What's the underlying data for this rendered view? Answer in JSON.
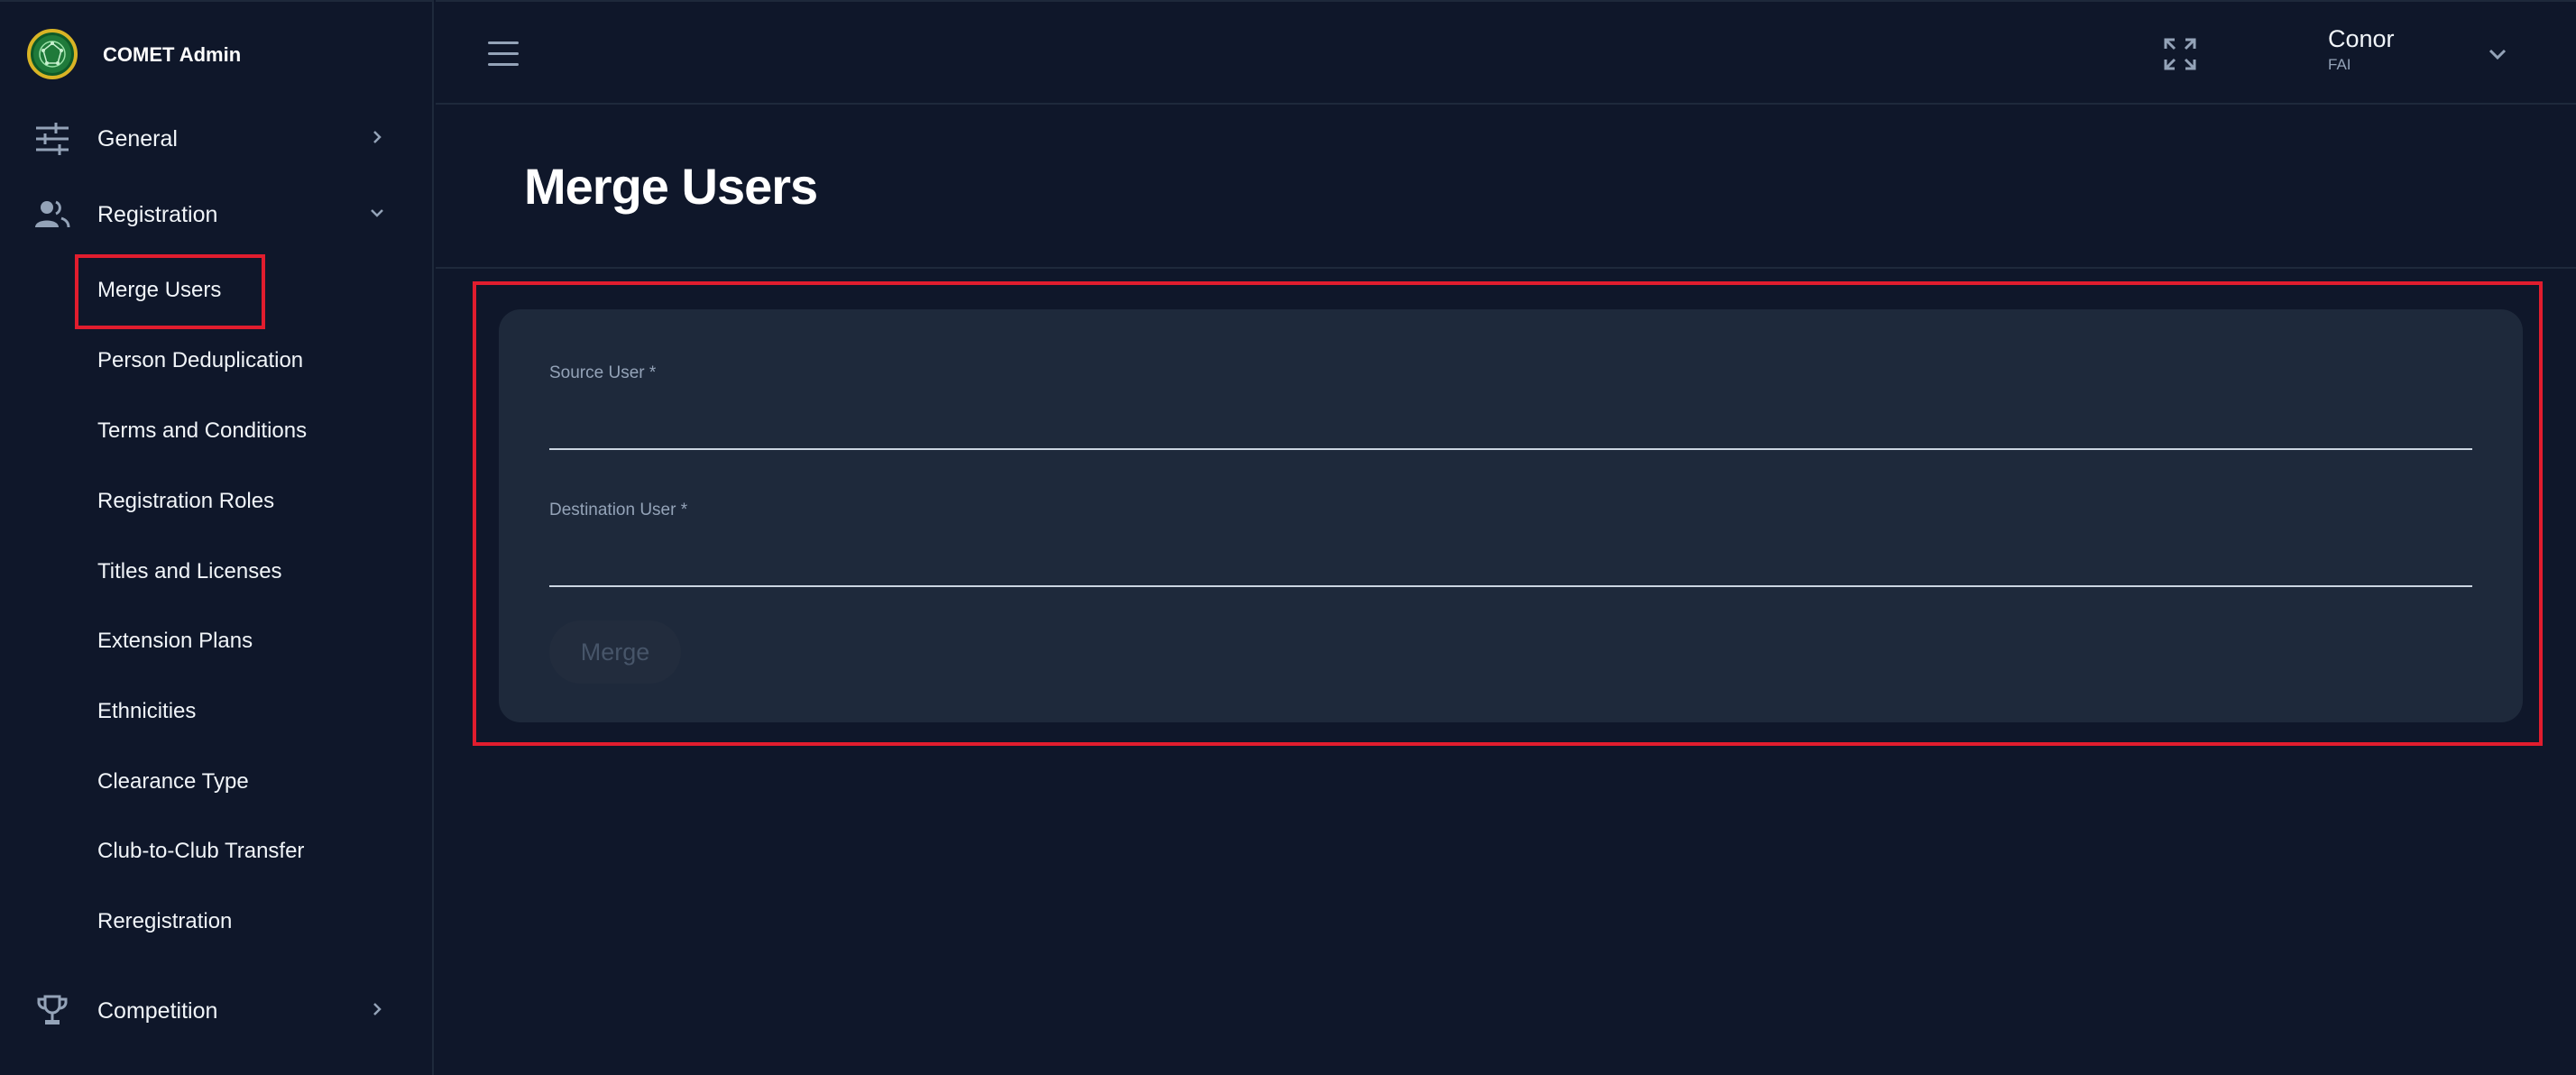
{
  "brand": {
    "name": "COMET Admin"
  },
  "sidebar": {
    "general_label": "General",
    "registration_label": "Registration",
    "competition_label": "Competition",
    "registration_items": [
      "Merge Users",
      "Person Deduplication",
      "Terms and Conditions",
      "Registration Roles",
      "Titles and Licenses",
      "Extension Plans",
      "Ethnicities",
      "Clearance Type",
      "Club-to-Club Transfer",
      "Reregistration"
    ]
  },
  "topbar": {
    "user_name": "Conor",
    "user_org": "FAI"
  },
  "page": {
    "title": "Merge Users"
  },
  "form": {
    "source_label": "Source User *",
    "source_value": "",
    "destination_label": "Destination User *",
    "destination_value": "",
    "merge_label": "Merge"
  },
  "colors": {
    "background": "#0f172a",
    "card": "#1e293b",
    "highlight": "#e11d2e",
    "text": "#f1f5f9",
    "muted": "#94a3b8"
  }
}
